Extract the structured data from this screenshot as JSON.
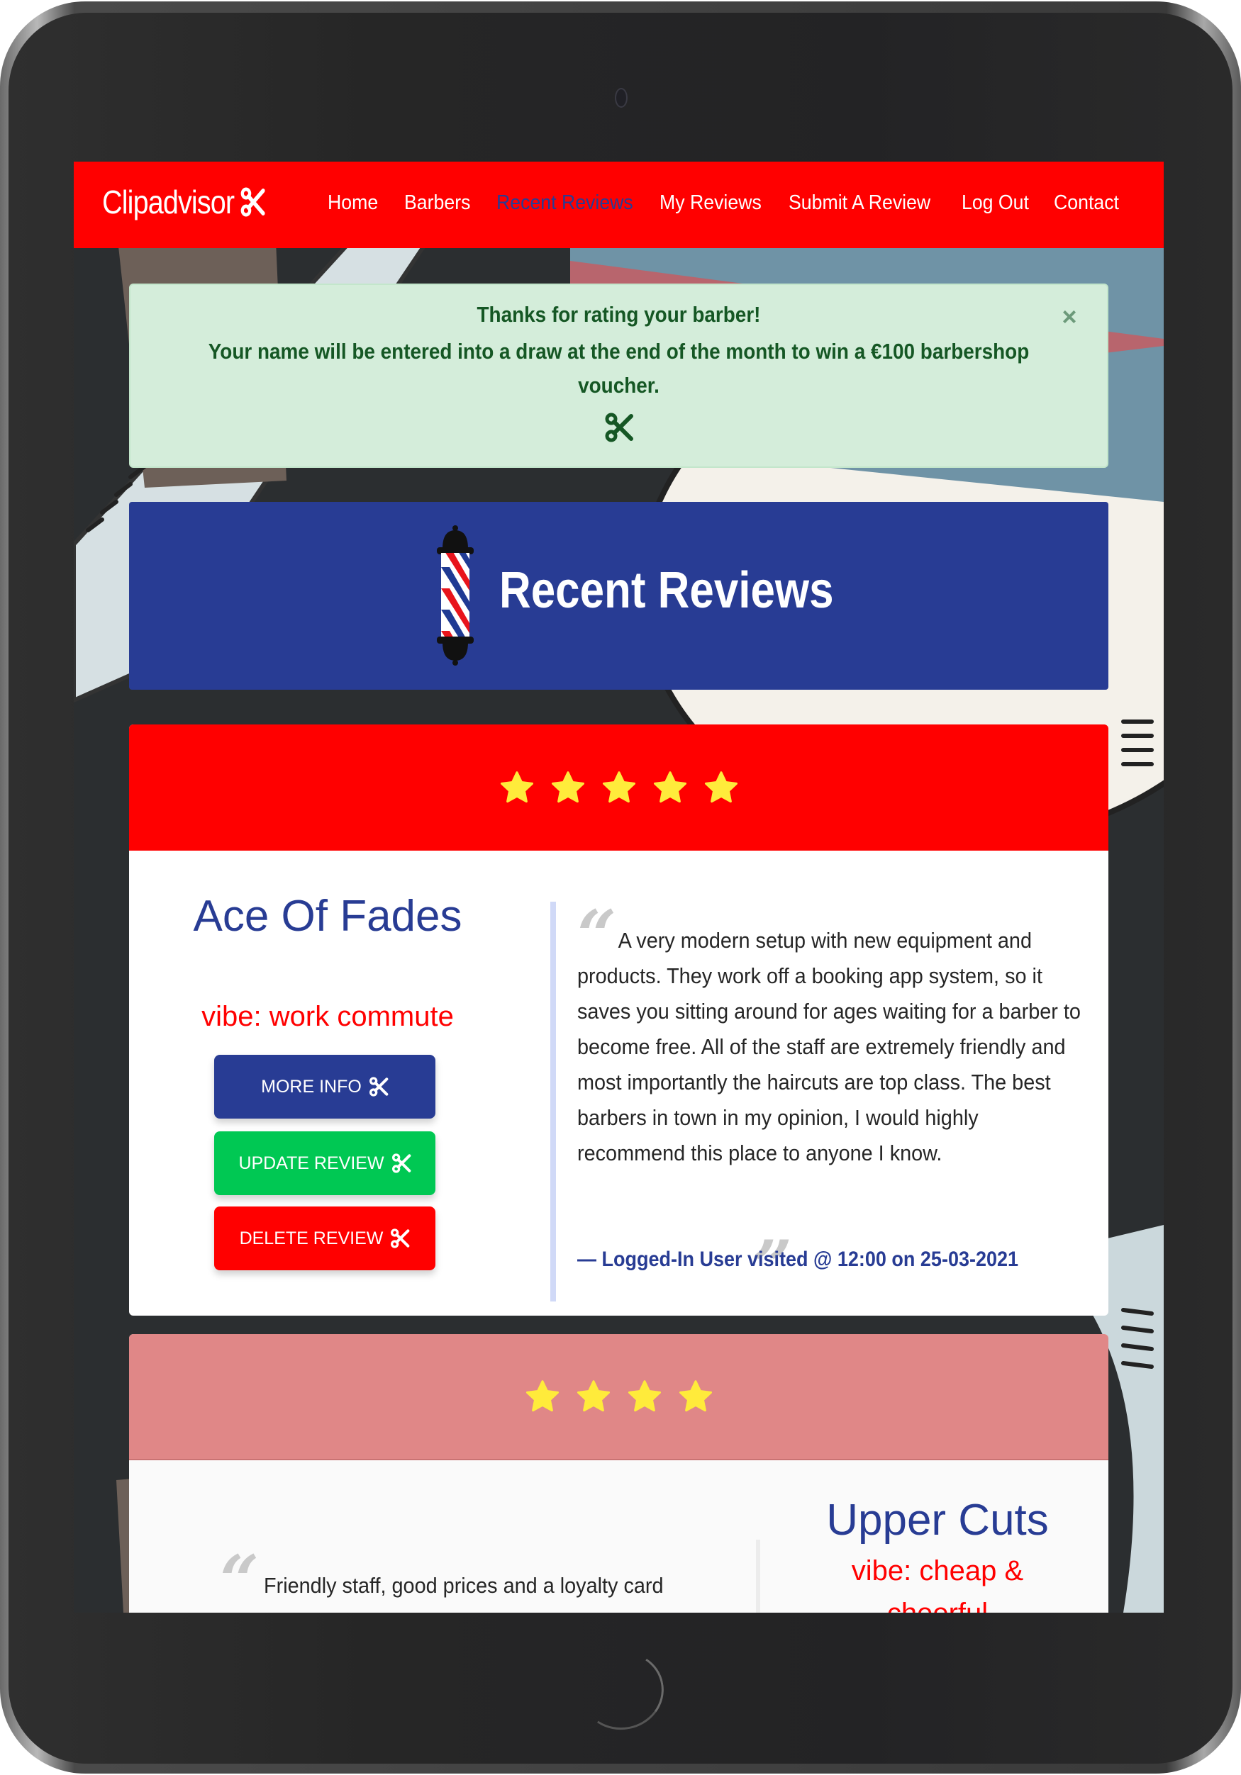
{
  "navbar": {
    "brand": "Clipadvisor",
    "links": [
      {
        "label": "Home",
        "active": false
      },
      {
        "label": "Barbers",
        "active": false
      },
      {
        "label": "Recent Reviews",
        "active": true
      },
      {
        "label": "My Reviews",
        "active": false
      },
      {
        "label": "Submit A Review",
        "active": false
      },
      {
        "label": "Log Out",
        "active": false
      },
      {
        "label": "Contact",
        "active": false
      }
    ]
  },
  "alert": {
    "title": "Thanks for rating your barber!",
    "message": "Your name will be entered into a draw at the end of the month to win a €100 barbershop voucher.",
    "close_label": "×"
  },
  "page": {
    "title": "Recent Reviews",
    "icon": "barber-pole-icon"
  },
  "reviews": [
    {
      "rating": 5,
      "star_bar_color": "#ff0000",
      "barber_name": "Ace Of Fades",
      "vibe": "vibe: work commute",
      "text": "A very modern setup with new equipment and products. They work off a booking app system, so it saves you sitting around for ages waiting for a barber to become free. All of the staff are extremely friendly and most importantly the haircuts are top class. The best barbers in town in my opinion, I would highly recommend this place to anyone I know.",
      "meta": "— Logged-In User visited @ 12:00 on 25-03-2021",
      "buttons": {
        "more_info": "MORE INFO",
        "update": "UPDATE REVIEW",
        "delete": "DELETE REVIEW"
      }
    },
    {
      "rating": 4,
      "star_bar_color": "#e08787",
      "barber_name": "Upper Cuts",
      "vibe_line1": "vibe: cheap &",
      "vibe_line2": "cheerful",
      "text": "Friendly staff, good prices and a loyalty card"
    }
  ],
  "colors": {
    "brand_red": "#ff0000",
    "brand_blue": "#283c94",
    "success_green": "#00c853",
    "alert_bg": "#d4edda",
    "alert_text": "#155724",
    "star": "#ffeb3b"
  }
}
